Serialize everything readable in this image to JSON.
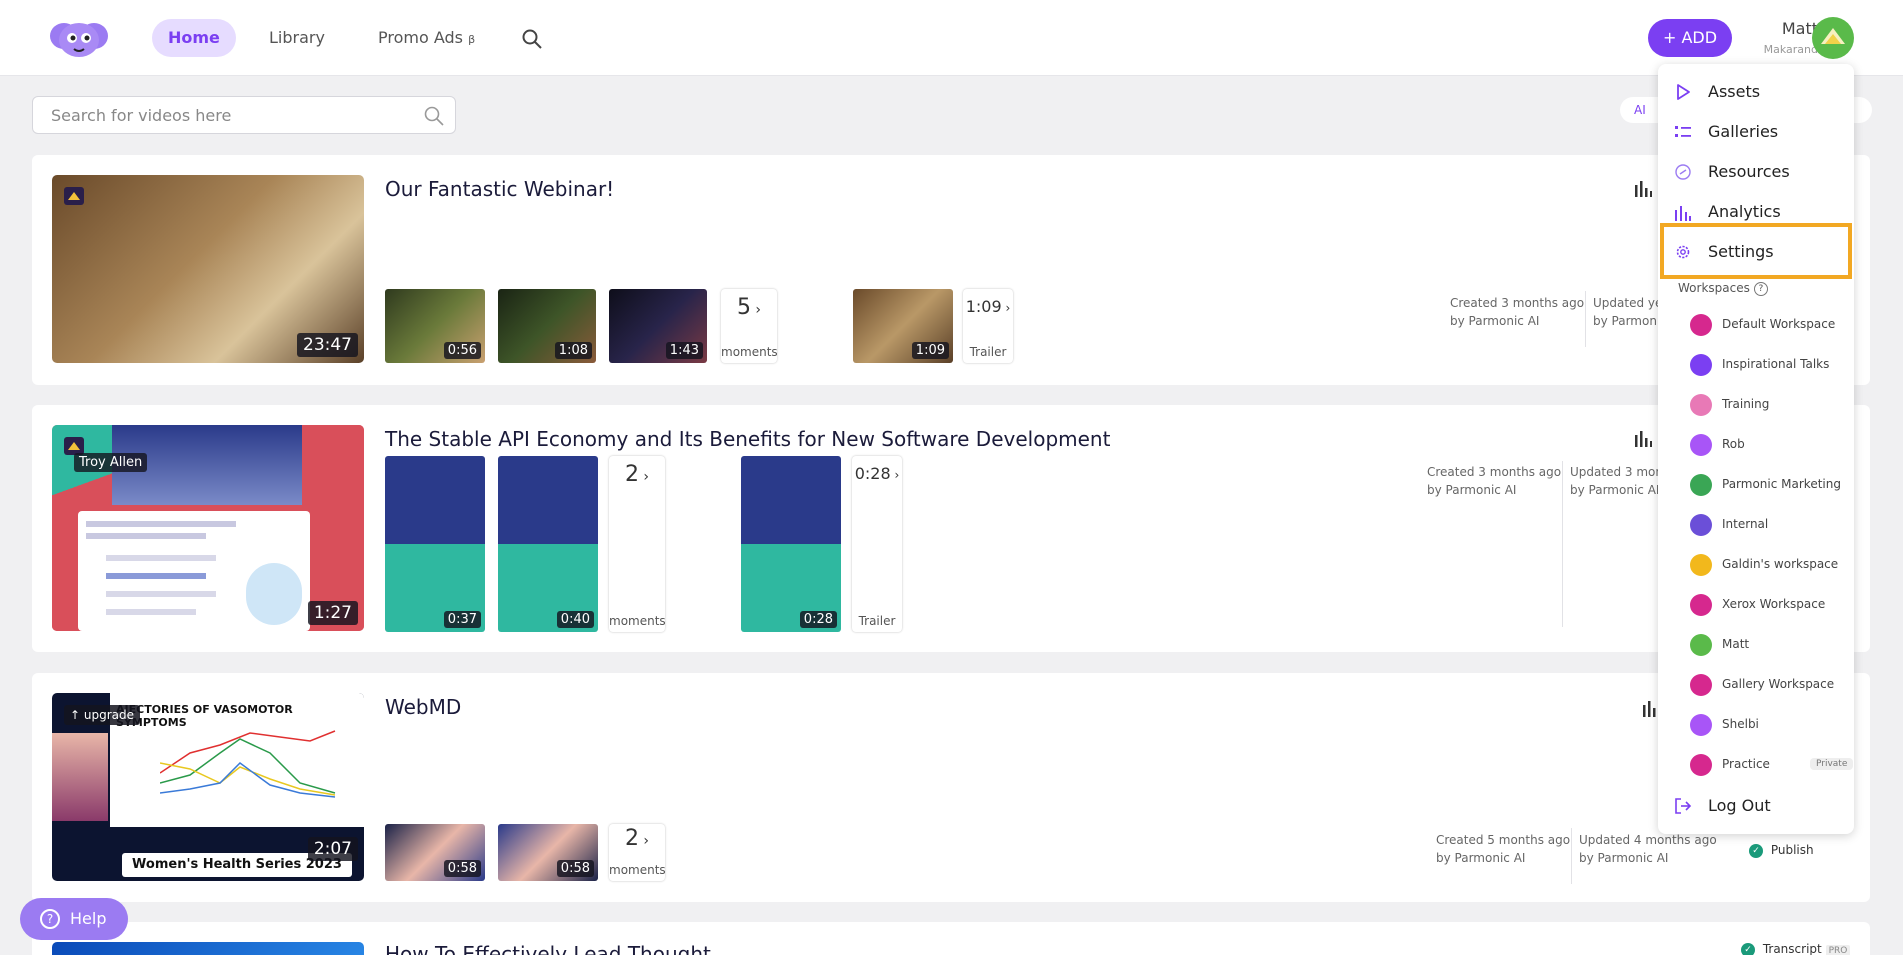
{
  "nav": {
    "home": "Home",
    "library": "Library",
    "promo": "Promo Ads",
    "promo_beta": "β",
    "add": "+ ADD",
    "user_name": "Matt",
    "user_workspace": "Makarand"
  },
  "search": {
    "placeholder": "Search for videos here",
    "ai_chip": "AI"
  },
  "videos": [
    {
      "title": "Our Fantastic Webinar!",
      "duration": "23:47",
      "clips": [
        "0:56",
        "1:08",
        "1:43"
      ],
      "moments_count": "5",
      "moments_label": "moments",
      "trailer_duration": "1:09",
      "trailer_clip_duration": "1:09",
      "trailer_label": "Trailer",
      "created": "Created 3 months ago",
      "created_by": "by Parmonic AI",
      "updated": "Updated ye",
      "updated_by": "by Parmonic"
    },
    {
      "title": "The Stable API Economy and Its Benefits for New Software Development",
      "duration": "1:27",
      "speaker": "Troy Allen",
      "clips": [
        "0:37",
        "0:40"
      ],
      "moments_count": "2",
      "moments_label": "moments",
      "trailer_duration": "0:28",
      "trailer_clip_duration": "0:28",
      "trailer_label": "Trailer",
      "created": "Created 3 months ago",
      "created_by": "by Parmonic AI",
      "updated": "Updated 3 mon",
      "updated_by": "by Parmonic AI"
    },
    {
      "title": "WebMD",
      "duration": "2:07",
      "upgrade": "↑ upgrade",
      "thumb_heading": "AJECTORIES OF VASOMOTOR SYMPTOMS",
      "thumb_footer": "Women's Health Series 2023",
      "clips": [
        "0:58",
        "0:58"
      ],
      "moments_count": "2",
      "moments_label": "moments",
      "created": "Created 5 months ago",
      "created_by": "by Parmonic AI",
      "updated": "Updated 4 months ago",
      "updated_by": "by Parmonic AI",
      "publish": "Publish"
    },
    {
      "title": "How To Effectively Lead Thought",
      "transcript": "Transcript",
      "transcript_badge": "PRO"
    }
  ],
  "menu": {
    "items": [
      {
        "label": "Assets",
        "icon": "play-icon"
      },
      {
        "label": "Galleries",
        "icon": "list-icon"
      },
      {
        "label": "Resources",
        "icon": "link-icon"
      },
      {
        "label": "Analytics",
        "icon": "bar-chart-icon"
      },
      {
        "label": "Settings",
        "icon": "gear-icon"
      }
    ],
    "workspaces_header": "Workspaces",
    "workspaces": [
      {
        "label": "Default Workspace",
        "color": "#d6288e"
      },
      {
        "label": "Inspirational Talks",
        "color": "#7b3ff2"
      },
      {
        "label": "Training",
        "color": "#e879b6"
      },
      {
        "label": "Rob",
        "color": "#a855f7"
      },
      {
        "label": "Parmonic Marketing",
        "color": "#3aa655"
      },
      {
        "label": "Internal",
        "color": "#6b4fd8"
      },
      {
        "label": "Galdin's workspace",
        "color": "#f2b81c"
      },
      {
        "label": "Xerox Workspace",
        "color": "#d6288e"
      },
      {
        "label": "Matt",
        "color": "#5aba4a"
      },
      {
        "label": "Gallery Workspace",
        "color": "#d6288e"
      },
      {
        "label": "Shelbi",
        "color": "#a855f7"
      },
      {
        "label": "Practice",
        "color": "#d6288e",
        "badge": "Private"
      }
    ],
    "logout": "Log Out"
  },
  "help": "Help",
  "colors": {
    "accent": "#7b3ff2",
    "highlight": "#f2a823"
  }
}
